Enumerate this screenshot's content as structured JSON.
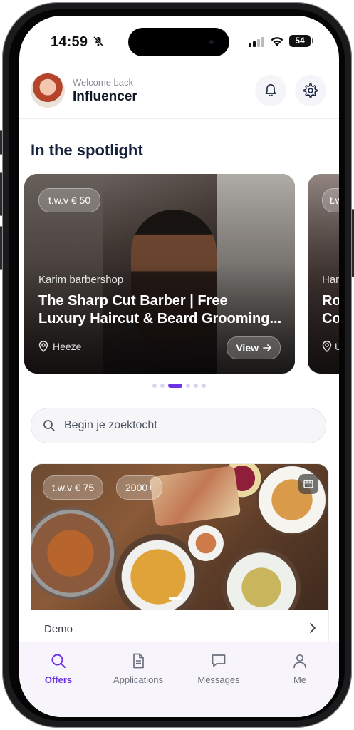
{
  "status_bar": {
    "time": "14:59",
    "battery": "54"
  },
  "header": {
    "welcome": "Welcome back",
    "username": "Influencer"
  },
  "spotlight": {
    "title": "In the spotlight",
    "cards": [
      {
        "price": "t.w.v € 50",
        "company": "Karim barbershop",
        "title_line1": "The Sharp Cut Barber | Free",
        "title_line2": "Luxury Haircut & Beard Grooming...",
        "location": "Heeze",
        "view_label": "View"
      },
      {
        "price": "t.w.v",
        "company": "Har",
        "title_line1": "Ro",
        "title_line2": "Co",
        "location": "U"
      }
    ],
    "active_page": 3,
    "page_count": 6
  },
  "search": {
    "placeholder": "Begin je zoektocht"
  },
  "offer": {
    "price": "t.w.v € 75",
    "followers": "2000+",
    "name": "Demo"
  },
  "tabs": [
    {
      "label": "Offers",
      "icon": "search-icon",
      "active": true
    },
    {
      "label": "Applications",
      "icon": "document-icon",
      "active": false
    },
    {
      "label": "Messages",
      "icon": "message-icon",
      "active": false
    },
    {
      "label": "Me",
      "icon": "person-icon",
      "active": false
    }
  ],
  "colors": {
    "accent": "#6b32e6",
    "tabbar_bg": "#f8f4fc",
    "title": "#15223b"
  }
}
